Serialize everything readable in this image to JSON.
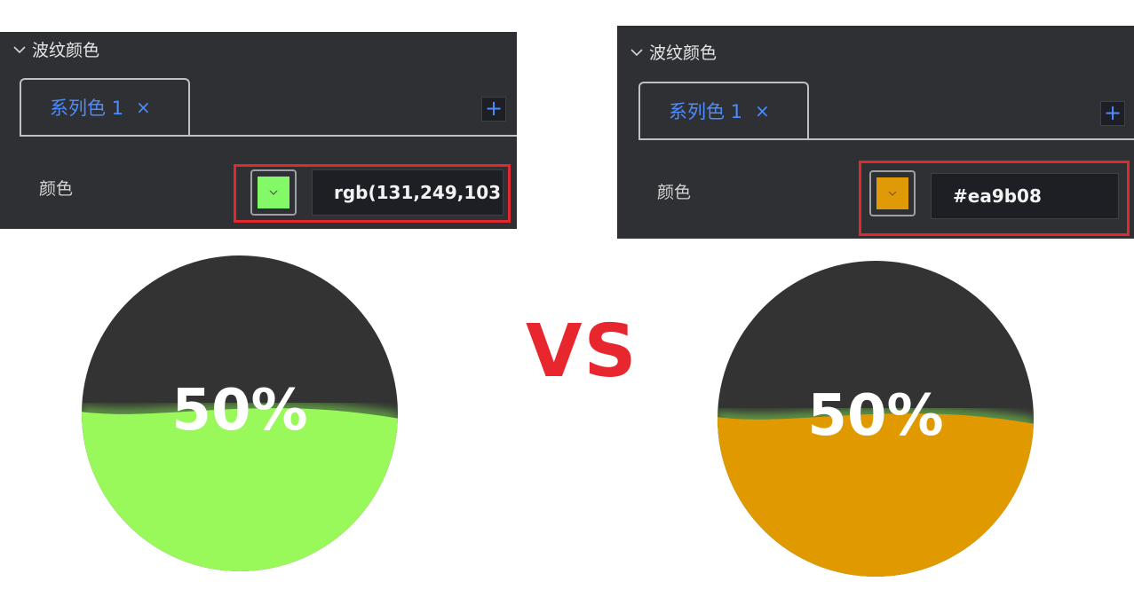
{
  "left": {
    "section_title": "波纹颜色",
    "tab_label": "系列色 1",
    "tab_close": "×",
    "add_button": "+",
    "field_label": "颜色",
    "color_value": "rgb(131,249,103",
    "swatch_color": "#83f967",
    "gauge": {
      "value_text": "50%",
      "percent": 50,
      "fill_color": "#9af95a",
      "background_color": "#333333"
    }
  },
  "right": {
    "section_title": "波纹颜色",
    "tab_label": "系列色 1",
    "tab_close": "×",
    "add_button": "+",
    "field_label": "颜色",
    "color_value": "#ea9b08",
    "swatch_color": "#e09a07",
    "gauge": {
      "value_text": "50%",
      "percent": 50,
      "fill_color": "#e09a00",
      "background_color": "#333333"
    }
  },
  "vs_label": "VS",
  "colors": {
    "panel_bg": "#2f3033",
    "accent_blue": "#4d8cff",
    "highlight_red": "#e0282d",
    "vs_red": "#e8262e",
    "glow_green": "#8dff5a"
  }
}
